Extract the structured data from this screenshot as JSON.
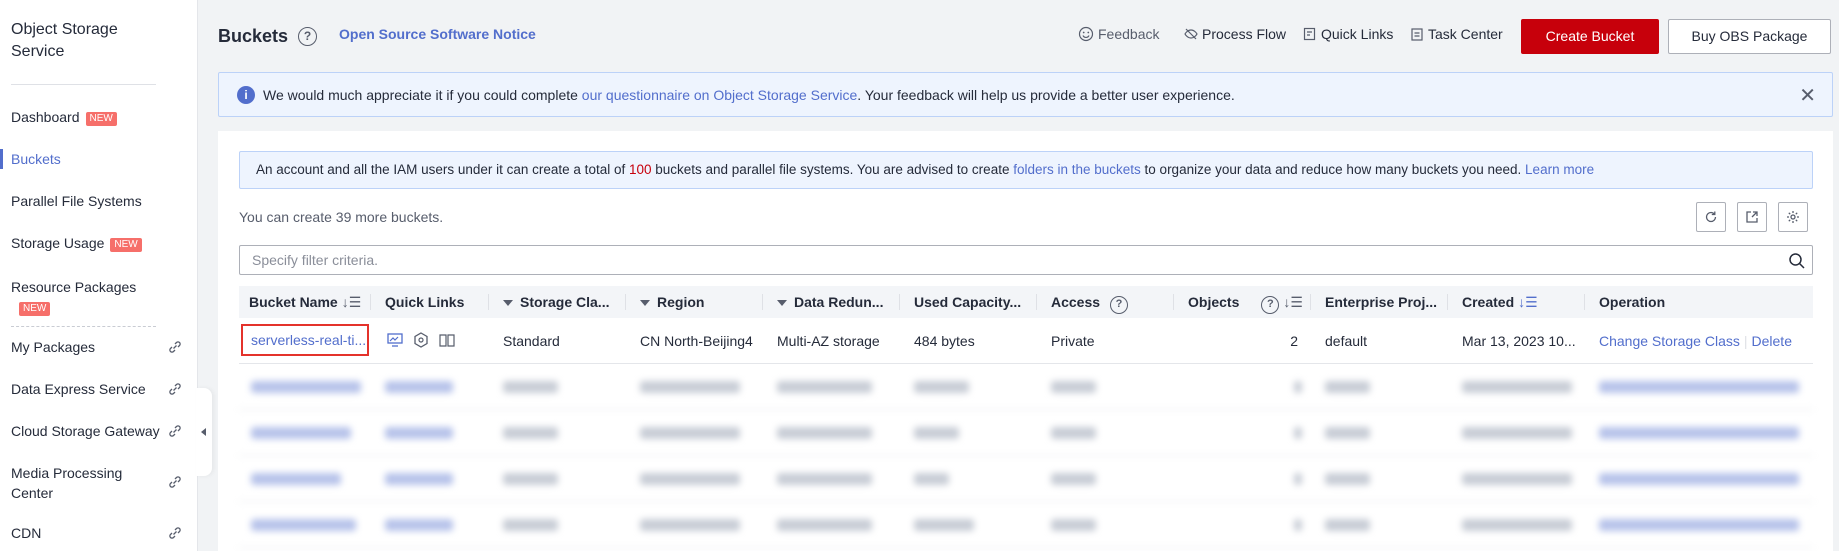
{
  "sidebar": {
    "title": "Object Storage Service",
    "items": [
      {
        "label": "Dashboard",
        "badge": "NEW"
      },
      {
        "label": "Buckets",
        "badge": ""
      },
      {
        "label": "Parallel File Systems",
        "badge": ""
      },
      {
        "label": "Storage Usage",
        "badge": "NEW"
      },
      {
        "label": "Resource Packages",
        "badge": "NEW"
      },
      {
        "label": "My Packages",
        "badge": ""
      },
      {
        "label": "Data Express Service",
        "badge": ""
      },
      {
        "label": "Cloud Storage Gateway",
        "badge": ""
      },
      {
        "label": "Media Processing Center",
        "badge": ""
      },
      {
        "label": "CDN",
        "badge": ""
      }
    ]
  },
  "header": {
    "title": "Buckets",
    "oss_notice": "Open Source Software Notice",
    "feedback": "Feedback",
    "process_flow": "Process Flow",
    "quick_links": "Quick Links",
    "task_center": "Task Center",
    "create_bucket": "Create Bucket",
    "buy_package": "Buy OBS Package"
  },
  "banner": {
    "text_before": "We would much appreciate it if you could complete ",
    "link": "our questionnaire on Object Storage Service",
    "text_after": ". Your feedback will help us provide a better user experience."
  },
  "tip": {
    "t1": "An account and all the IAM users under it can create a total of ",
    "count": "100",
    "t2": " buckets and parallel file systems. You are advised to create ",
    "link1": "folders in the buckets",
    "t3": " to organize your data and reduce how many buckets you need. ",
    "link2": "Learn more"
  },
  "remaining": "You can create 39 more buckets.",
  "search_placeholder": "Specify filter criteria.",
  "columns": {
    "bucket_name": "Bucket Name",
    "quick_links": "Quick Links",
    "storage_class": "Storage Cla...",
    "region": "Region",
    "redundancy": "Data Redun...",
    "used_capacity": "Used Capacity...",
    "access": "Access",
    "objects": "Objects",
    "enterprise_project": "Enterprise Proj...",
    "created": "Created",
    "operation": "Operation"
  },
  "rows": [
    {
      "bucket_name": "serverless-real-ti...",
      "storage_class": "Standard",
      "region": "CN North-Beijing4",
      "redundancy": "Multi-AZ storage",
      "used_capacity": "484 bytes",
      "access": "Private",
      "objects": "2",
      "enterprise_project": "default",
      "created": "Mar 13, 2023 10...",
      "op_change": "Change Storage Class",
      "op_delete": "Delete"
    }
  ]
}
